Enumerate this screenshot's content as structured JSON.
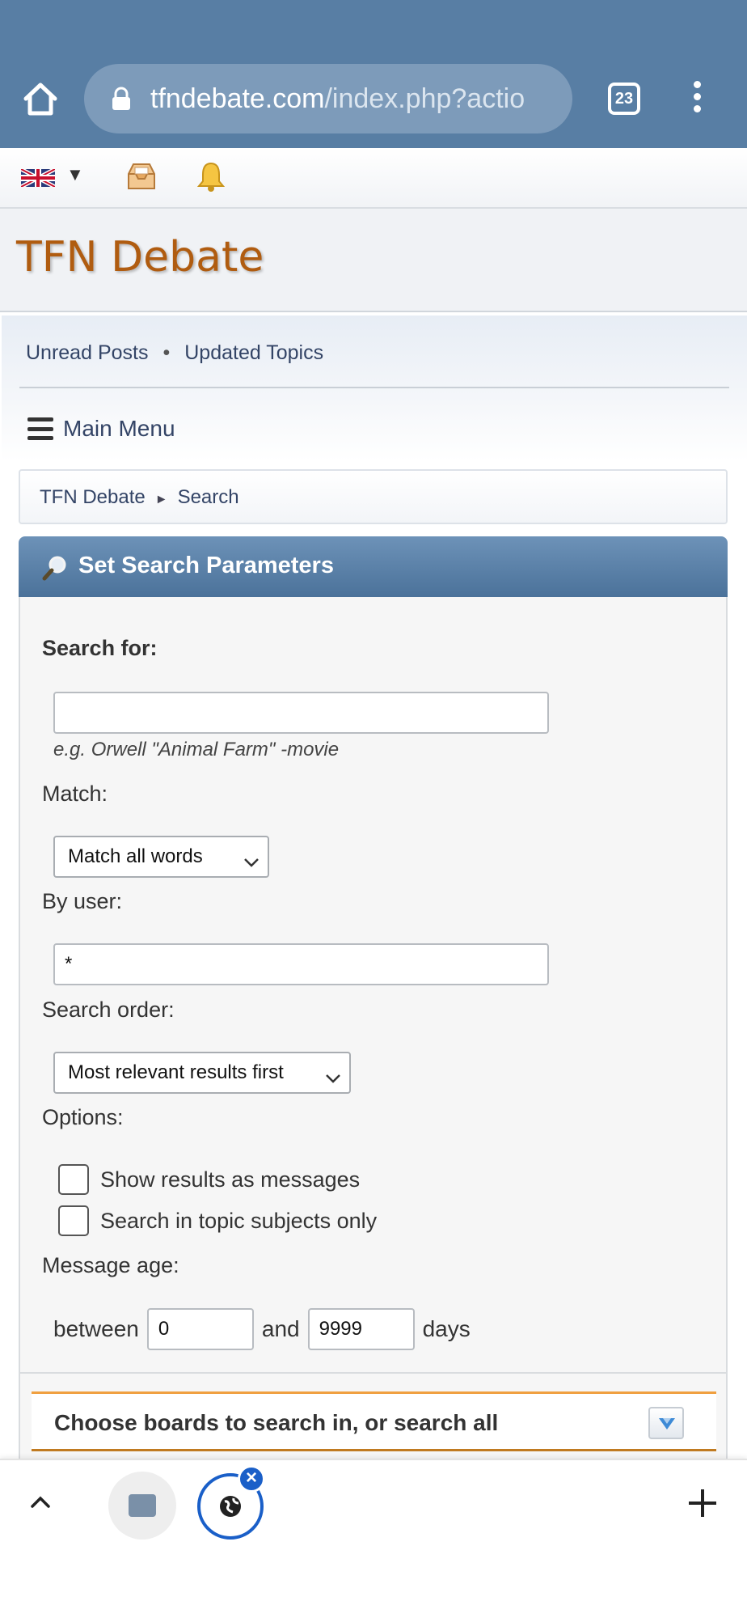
{
  "browser": {
    "url_domain": "tfndebate.com",
    "url_path": "/index.php?actio",
    "tab_count": "23"
  },
  "userbar": {
    "language_caret": "▼"
  },
  "site": {
    "title": "TFN Debate"
  },
  "nav": {
    "links": [
      "Unread Posts",
      "Updated Topics"
    ],
    "separator": "•",
    "menu_label": "Main Menu"
  },
  "breadcrumb": {
    "items": [
      "TFN Debate",
      "Search"
    ],
    "separator": "►"
  },
  "search": {
    "panel_title": "Set Search Parameters",
    "search_for_label": "Search for:",
    "search_for_value": "",
    "search_hint": "e.g. Orwell \"Animal Farm\" -movie",
    "match_label": "Match:",
    "match_value": "Match all words",
    "by_user_label": "By user:",
    "by_user_value": "*",
    "order_label": "Search order:",
    "order_value": "Most relevant results first",
    "options_label": "Options:",
    "options": [
      {
        "label": "Show results as messages",
        "checked": false
      },
      {
        "label": "Search in topic subjects only",
        "checked": false
      }
    ],
    "age_label": "Message age:",
    "age_between": "between",
    "age_min": "0",
    "age_and": "and",
    "age_max": "9999",
    "age_days": "days"
  },
  "boards": {
    "title": "Choose boards to search in, or search all"
  },
  "colors": {
    "chrome": "#587ea4",
    "site_title": "#b05c10",
    "panel_header": "#5a80a8",
    "accent_tab": "#1a5fc8",
    "boards_border": "#f0a040"
  }
}
